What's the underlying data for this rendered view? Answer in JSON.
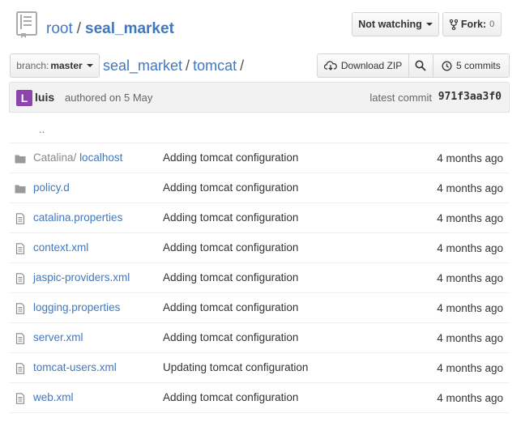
{
  "repo": {
    "owner": "root",
    "separator": "/",
    "name": "seal_market"
  },
  "actions": {
    "watch_label": "Not watching",
    "fork_label": "Fork:",
    "fork_count": "0"
  },
  "branch": {
    "label": "branch:",
    "name": "master"
  },
  "path": {
    "root": "seal_market",
    "current": "tomcat",
    "sep1": "/",
    "sep2": "/"
  },
  "toolbar": {
    "download_label": "Download ZIP",
    "commits_label": "5 commits"
  },
  "commit": {
    "avatar_letter": "L",
    "author": "luis",
    "authored_text": "authored on 5 May",
    "latest_label": "latest commit",
    "sha": "971f3aa3f0"
  },
  "files": {
    "up_label": "..",
    "rows": [
      {
        "type": "folder",
        "prefix": "Catalina/",
        "name": "localhost",
        "message": "Adding tomcat configuration",
        "age": "4 months ago"
      },
      {
        "type": "folder",
        "prefix": "",
        "name": "policy.d",
        "message": "Adding tomcat configuration",
        "age": "4 months ago"
      },
      {
        "type": "file",
        "prefix": "",
        "name": "catalina.properties",
        "message": "Adding tomcat configuration",
        "age": "4 months ago"
      },
      {
        "type": "file",
        "prefix": "",
        "name": "context.xml",
        "message": "Adding tomcat configuration",
        "age": "4 months ago"
      },
      {
        "type": "file",
        "prefix": "",
        "name": "jaspic-providers.xml",
        "message": "Adding tomcat configuration",
        "age": "4 months ago"
      },
      {
        "type": "file",
        "prefix": "",
        "name": "logging.properties",
        "message": "Adding tomcat configuration",
        "age": "4 months ago"
      },
      {
        "type": "file",
        "prefix": "",
        "name": "server.xml",
        "message": "Adding tomcat configuration",
        "age": "4 months ago"
      },
      {
        "type": "file",
        "prefix": "",
        "name": "tomcat-users.xml",
        "message": "Updating tomcat configuration",
        "age": "4 months ago"
      },
      {
        "type": "file",
        "prefix": "",
        "name": "web.xml",
        "message": "Adding tomcat configuration",
        "age": "4 months ago"
      }
    ]
  },
  "colors": {
    "link": "#4078c0",
    "avatar": "#8e44ad"
  },
  "icons": {
    "repo": "book-icon",
    "download": "cloud-download-icon",
    "search": "search-icon",
    "history": "history-icon",
    "folder": "folder-icon",
    "file": "file-text-icon",
    "fork": "fork-icon"
  }
}
